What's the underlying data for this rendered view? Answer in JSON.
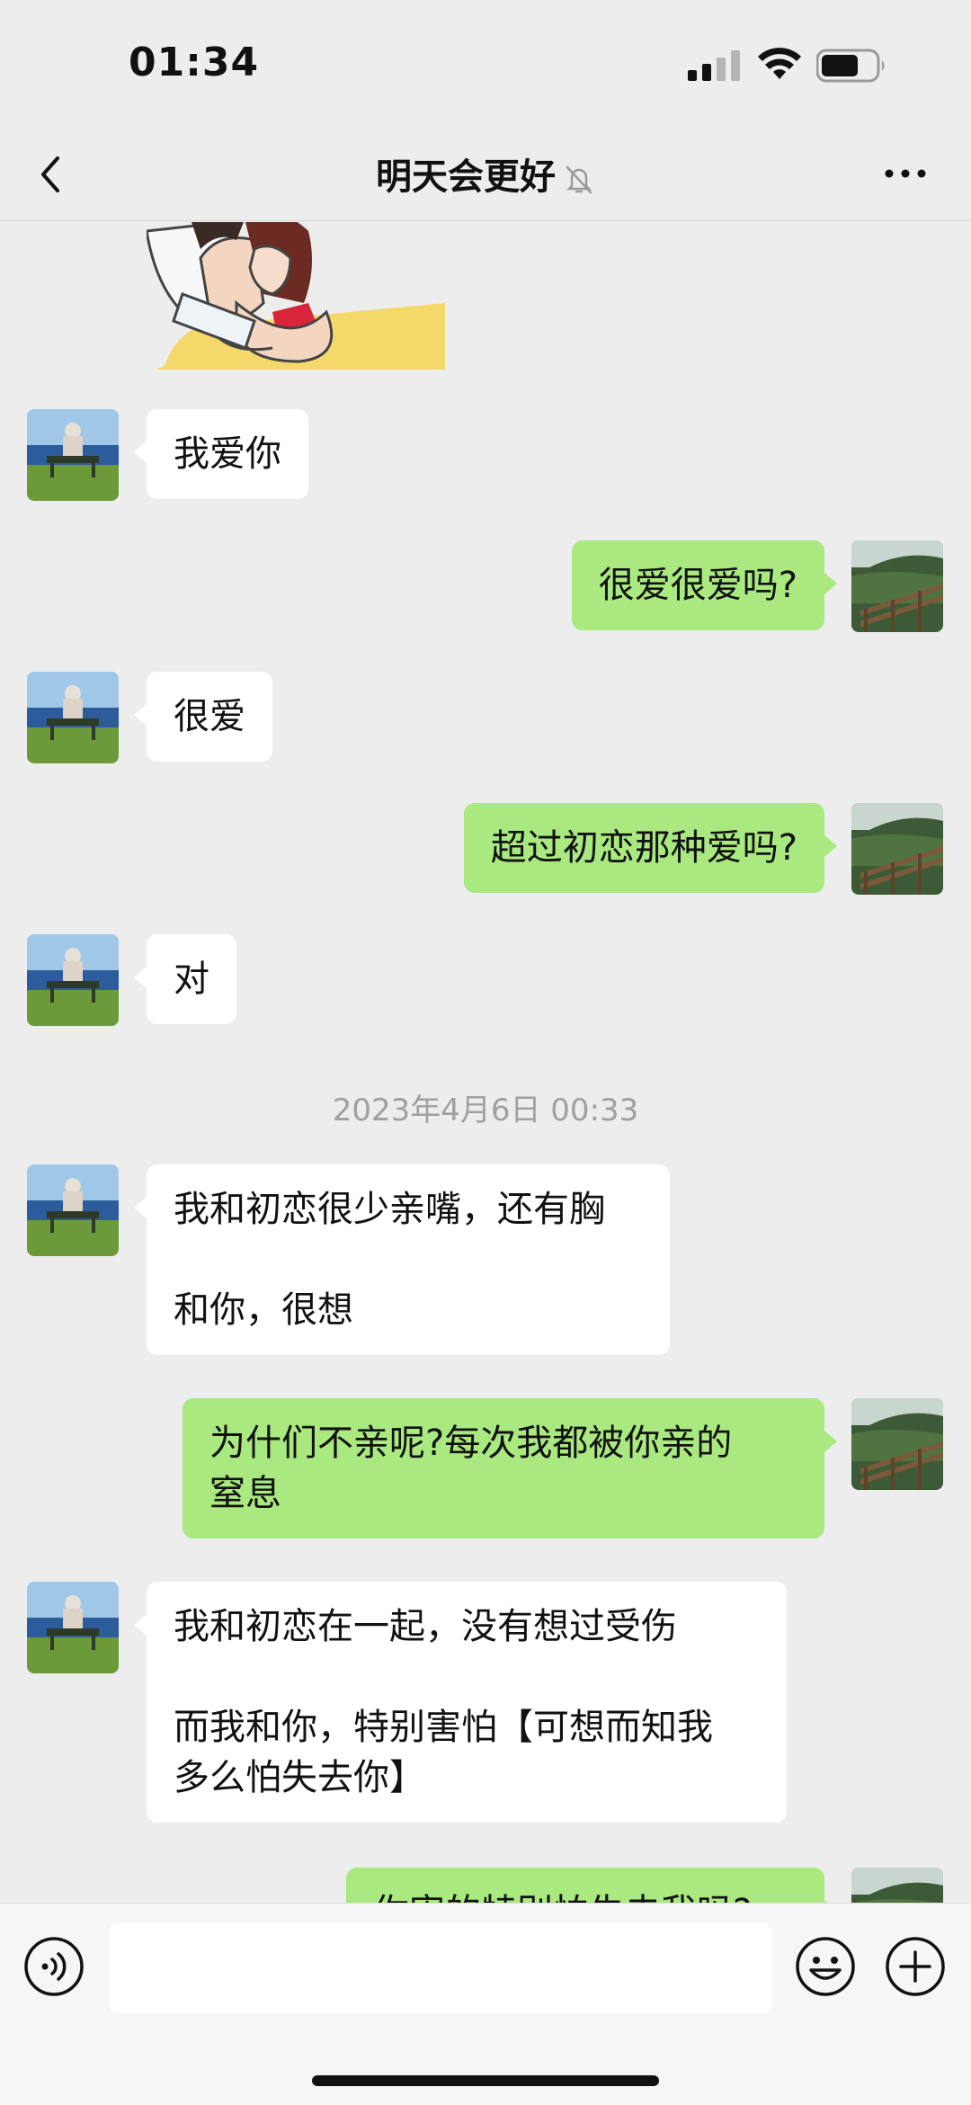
{
  "status_bar": {
    "time": "01:34"
  },
  "header": {
    "title": "明天会更好",
    "muted": true
  },
  "timestamps": [
    "2023年4月6日 00:33"
  ],
  "messages": [
    {
      "from": "them",
      "text": "我爱你"
    },
    {
      "from": "me",
      "text": "很爱很爱吗?"
    },
    {
      "from": "them",
      "text": "很爱"
    },
    {
      "from": "me",
      "text": "超过初恋那种爱吗?"
    },
    {
      "from": "them",
      "text": "对"
    },
    {
      "from": "them",
      "text": "我和初恋很少亲嘴，还有胸\n\n和你，很想"
    },
    {
      "from": "me",
      "text": "为什们不亲呢?每次我都被你亲的\n窒息"
    },
    {
      "from": "them",
      "text": "我和初恋在一起，没有想过受伤\n\n而我和你，特别害怕【可想而知我\n多么怕失去你】"
    },
    {
      "from": "me",
      "text": "你害的特别怕失去我吗?"
    }
  ],
  "icons": {
    "back": "back-chevron-icon",
    "mute": "bell-off-icon",
    "more": "more-dots-icon",
    "voice": "voice-icon",
    "emoji": "emoji-icon",
    "plus": "plus-icon"
  },
  "colors": {
    "background": "#ededed",
    "incoming_bubble": "#ffffff",
    "outgoing_bubble": "#a9e97f",
    "timestamp": "#a0a0a0"
  }
}
